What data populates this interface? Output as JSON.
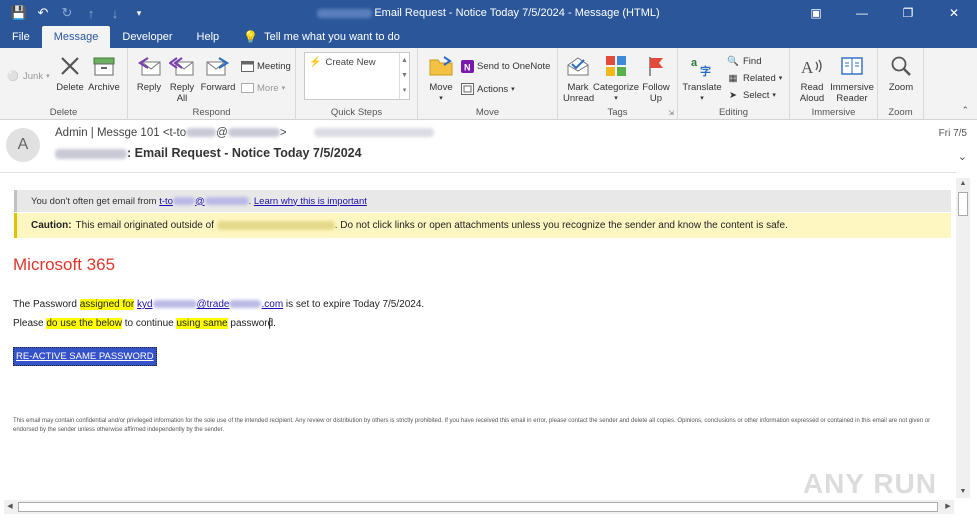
{
  "window": {
    "title": "Email Request - Notice Today 7/5/2024  -  Message (HTML)"
  },
  "tabs": [
    {
      "label": "File"
    },
    {
      "label": "Message"
    },
    {
      "label": "Developer"
    },
    {
      "label": "Help"
    },
    {
      "label": "Tell me what you want to do"
    }
  ],
  "ribbon": {
    "junk": "Junk",
    "delete": "Delete",
    "archive": "Archive",
    "group_delete": "Delete",
    "reply": "Reply",
    "reply_all": "Reply All",
    "forward": "Forward",
    "meeting": "Meeting",
    "more": "More",
    "group_respond": "Respond",
    "create_new": "Create New",
    "group_quick_steps": "Quick Steps",
    "move": "Move",
    "send_to_onenote": "Send to OneNote",
    "actions": "Actions",
    "group_move": "Move",
    "mark_unread": "Mark Unread",
    "categorize": "Categorize",
    "follow_up": "Follow Up",
    "group_tags": "Tags",
    "translate": "Translate",
    "find": "Find",
    "related": "Related",
    "select": "Select",
    "group_editing": "Editing",
    "read_aloud": "Read Aloud",
    "immersive_reader": "Immersive Reader",
    "group_immersive": "Immersive",
    "zoom": "Zoom",
    "group_zoom": "Zoom"
  },
  "message": {
    "avatar_letter": "A",
    "sender_prefix": "Admin | Messge 101 <t-to",
    "sender_suffix": ">",
    "subject": ": Email Request - Notice Today 7/5/2024",
    "date": "Fri 7/5"
  },
  "body": {
    "banner1_prefix": "You don't often get email from ",
    "banner1_link": "t-to",
    "banner1_link2": "Learn why this is important",
    "banner2_bold": "Caution:",
    "banner2_prefix": "This email originated outside of",
    "banner2_suffix": ". Do not click links or open attachments unless you recognize the sender and know the content is safe.",
    "ms365": "Microsoft 365",
    "p1_a": "The Password ",
    "p1_hl": "assigned for",
    "p1_b": " ",
    "p1_link_a": "kyd",
    "p1_link_b": "@trade",
    "p1_link_c": ".com",
    "p1_c": "  is set to expire Today 7/5/2024.",
    "p2_a": "Please ",
    "p2_hl1": "do use the below",
    "p2_b": " to continue ",
    "p2_hl2": "using same",
    "p2_c": " password.",
    "cta": "RE-ACTIVE SAME PASSWORD",
    "disclaimer": "This email may contain confidential and/or privileged information for the sole use of the intended recipient. Any review or distribution by others is strictly prohibited. If you have received this email in error, please contact the sender and delete all copies. Opinions, conclusions or other information expressed or contained in this email are not given or endorsed by the sender unless otherwise affirmed independently by the sender."
  },
  "watermark": "ANY RUN",
  "colors": {
    "titlebar": "#2b579a",
    "ms365_red": "#e0352b",
    "highlight": "#ffff00",
    "cta_bg": "#3552c8"
  }
}
